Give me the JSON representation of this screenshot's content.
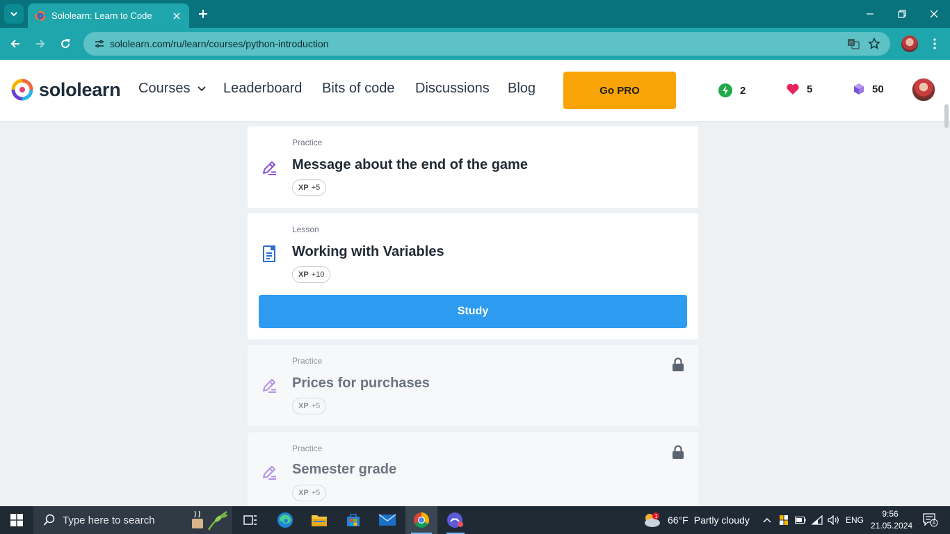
{
  "browser": {
    "tab_title": "Sololearn: Learn to Code",
    "url": "sololearn.com/ru/learn/courses/python-introduction"
  },
  "header": {
    "logo_text": "sololearn",
    "nav": [
      {
        "label": "Courses"
      },
      {
        "label": "Leaderboard"
      },
      {
        "label": "Bits of code"
      },
      {
        "label": "Discussions"
      },
      {
        "label": "Blog"
      }
    ],
    "go_pro_label": "Go PRO",
    "streak": "2",
    "hearts": "5",
    "gems": "50"
  },
  "lessons": [
    {
      "kind": "Practice",
      "title": "Message about the end of the game",
      "xp_label": "XP",
      "xp": "+5",
      "locked": false
    },
    {
      "kind": "Lesson",
      "title": "Working with Variables",
      "xp_label": "XP",
      "xp": "+10",
      "locked": false,
      "action": "Study"
    },
    {
      "kind": "Practice",
      "title": "Prices for purchases",
      "xp_label": "XP",
      "xp": "+5",
      "locked": true
    },
    {
      "kind": "Practice",
      "title": "Semester grade",
      "xp_label": "XP",
      "xp": "+5",
      "locked": true
    }
  ],
  "taskbar": {
    "search_placeholder": "Type here to search",
    "weather_temp": "66°F",
    "weather_desc": "Partly cloudy",
    "weather_badge": "1",
    "language": "ENG",
    "time": "9:56",
    "date": "21.05.2024",
    "notification_count": "1"
  },
  "colors": {
    "tabstrip": "#08737c",
    "toolbar": "#1fa6ad",
    "go_pro": "#f9a406",
    "study_button": "#2d9cf0",
    "practice_icon": "#8a4fd6",
    "lesson_icon": "#2a6fd1"
  }
}
